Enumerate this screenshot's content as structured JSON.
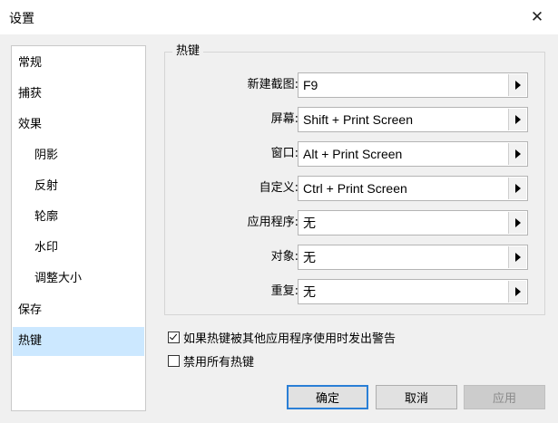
{
  "window": {
    "title": "设置",
    "close_icon": "close-icon"
  },
  "sidebar": {
    "items": [
      {
        "label": "常规",
        "level": 0,
        "selected": false
      },
      {
        "label": "捕获",
        "level": 0,
        "selected": false
      },
      {
        "label": "效果",
        "level": 0,
        "selected": false
      },
      {
        "label": "阴影",
        "level": 1,
        "selected": false
      },
      {
        "label": "反射",
        "level": 1,
        "selected": false
      },
      {
        "label": "轮廓",
        "level": 1,
        "selected": false
      },
      {
        "label": "水印",
        "level": 1,
        "selected": false
      },
      {
        "label": "调整大小",
        "level": 1,
        "selected": false
      },
      {
        "label": "保存",
        "level": 0,
        "selected": false
      },
      {
        "label": "热键",
        "level": 0,
        "selected": true
      }
    ]
  },
  "hotkeys": {
    "group_title": "热键",
    "rows": [
      {
        "label": "新建截图:",
        "value": "F9"
      },
      {
        "label": "屏幕:",
        "value": "Shift + Print Screen"
      },
      {
        "label": "窗口:",
        "value": "Alt + Print Screen"
      },
      {
        "label": "自定义:",
        "value": "Ctrl + Print Screen"
      },
      {
        "label": "应用程序:",
        "value": "无"
      },
      {
        "label": "对象:",
        "value": "无"
      },
      {
        "label": "重复:",
        "value": "无"
      }
    ]
  },
  "options": {
    "warn_on_conflict": {
      "label": "如果热键被其他应用程序使用时发出警告",
      "checked": true
    },
    "disable_all": {
      "label": "禁用所有热键",
      "checked": false
    }
  },
  "buttons": {
    "ok": "确定",
    "cancel": "取消",
    "apply": "应用"
  }
}
